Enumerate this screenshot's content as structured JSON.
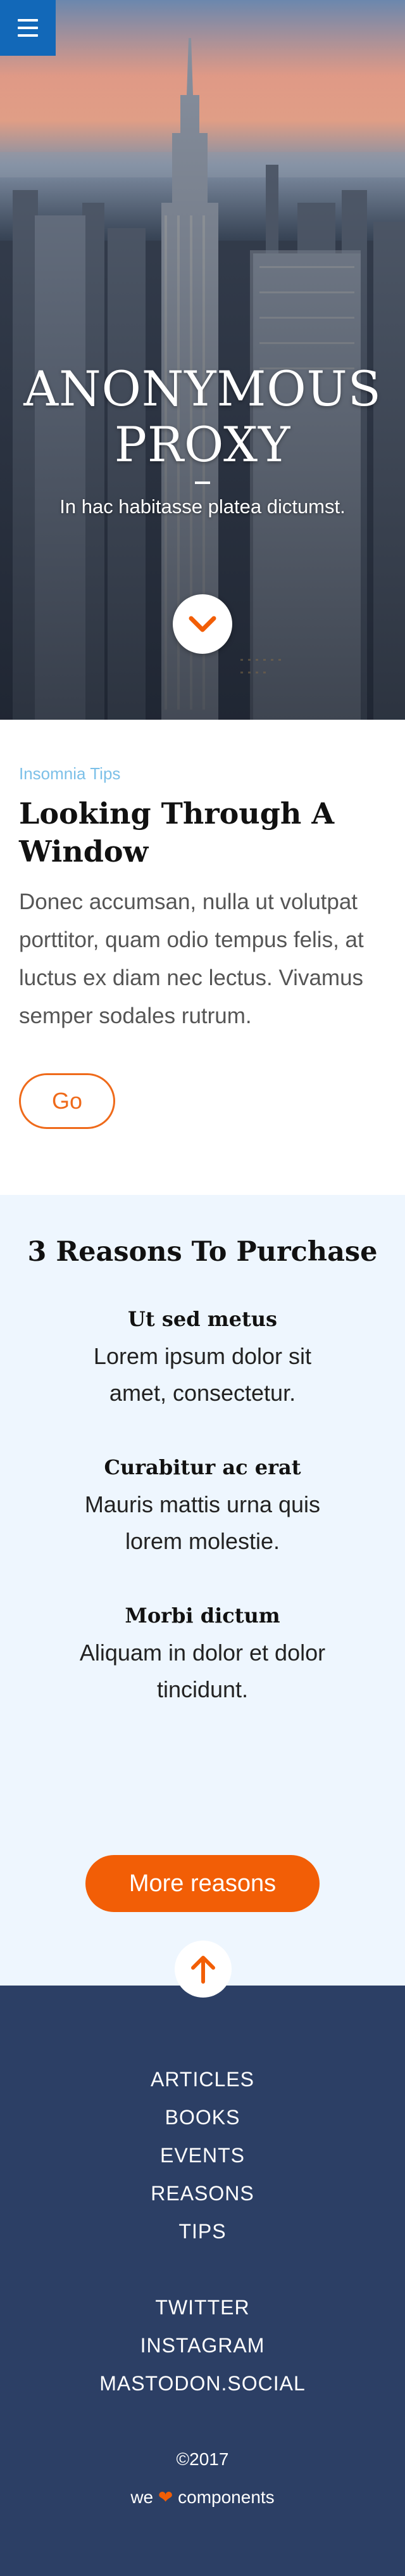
{
  "menu": {
    "icon": "hamburger-icon"
  },
  "hero": {
    "title": "ANONYMOUS PROXY",
    "subtitle": "In hac habitasse platea dictumst.",
    "scroll_icon": "chevron-down-icon"
  },
  "article": {
    "kicker": "Insomnia Tips",
    "title": "Looking Through A Window",
    "body": "Donec accumsan, nulla ut volutpat porttitor, quam odio tempus felis, at luctus ex diam nec lectus. Vivamus semper sodales rutrum.",
    "button": "Go"
  },
  "reasons": {
    "heading": "3 Reasons To Purchase",
    "items": [
      {
        "title": "Ut sed metus",
        "text": "Lorem ipsum dolor sit amet, consectetur."
      },
      {
        "title": "Curabitur ac erat",
        "text": "Mauris mattis urna quis lorem molestie."
      },
      {
        "title": "Morbi dictum",
        "text": "Aliquam in dolor et dolor tincidunt."
      }
    ],
    "button": "More reasons",
    "scroll_icon": "arrow-up-icon"
  },
  "footer": {
    "nav": [
      "ARTICLES",
      "BOOKS",
      "EVENTS",
      "REASONS",
      "TIPS"
    ],
    "social": [
      "TWITTER",
      "INSTAGRAM",
      "MASTODON.SOCIAL"
    ],
    "copyright": "©2017",
    "credit_prefix": "we",
    "credit_icon": "heart-icon",
    "credit_suffix": "components"
  },
  "colors": {
    "accent_orange": "#f25e06",
    "menu_blue": "#1268b8",
    "footer_navy": "#2c3f65",
    "reasons_bg": "#eef6fe",
    "kicker_blue": "#7cc0e8"
  }
}
